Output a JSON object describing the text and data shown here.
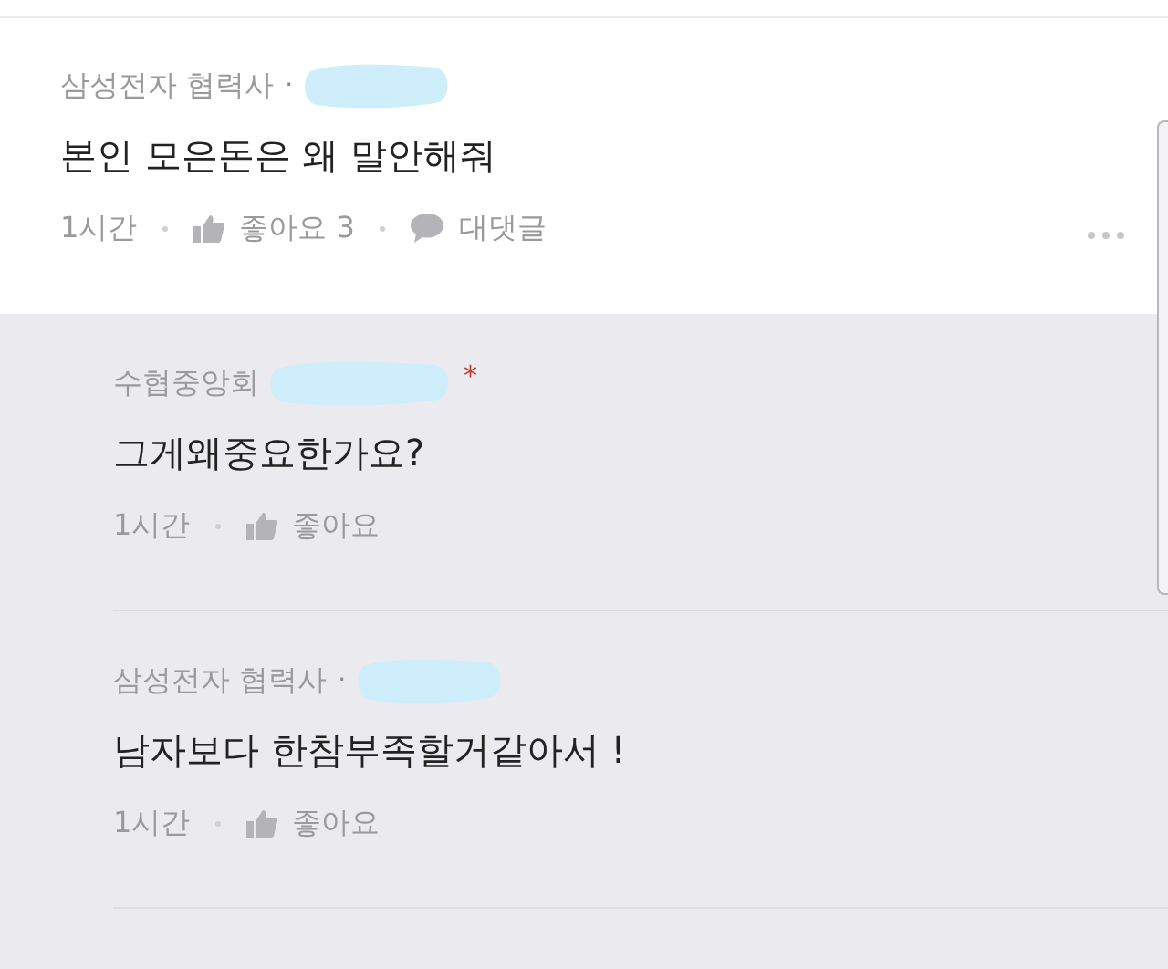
{
  "comments": [
    {
      "kind": "comment",
      "company": "삼성전자 협력사",
      "separator": "·",
      "body": "본인 모은돈은 왜 말안해줘",
      "time": "1시간",
      "like": "좋아요 3",
      "reply": "대댓글"
    },
    {
      "kind": "reply",
      "company": "수협중앙회",
      "badge": "*",
      "body": "그게왜중요한가요?",
      "time": "1시간",
      "like": "좋아요"
    },
    {
      "kind": "reply",
      "company": "삼성전자 협력사",
      "separator": "·",
      "body": "남자보다 한참부족할거같아서 !",
      "time": "1시간",
      "like": "좋아요"
    }
  ]
}
